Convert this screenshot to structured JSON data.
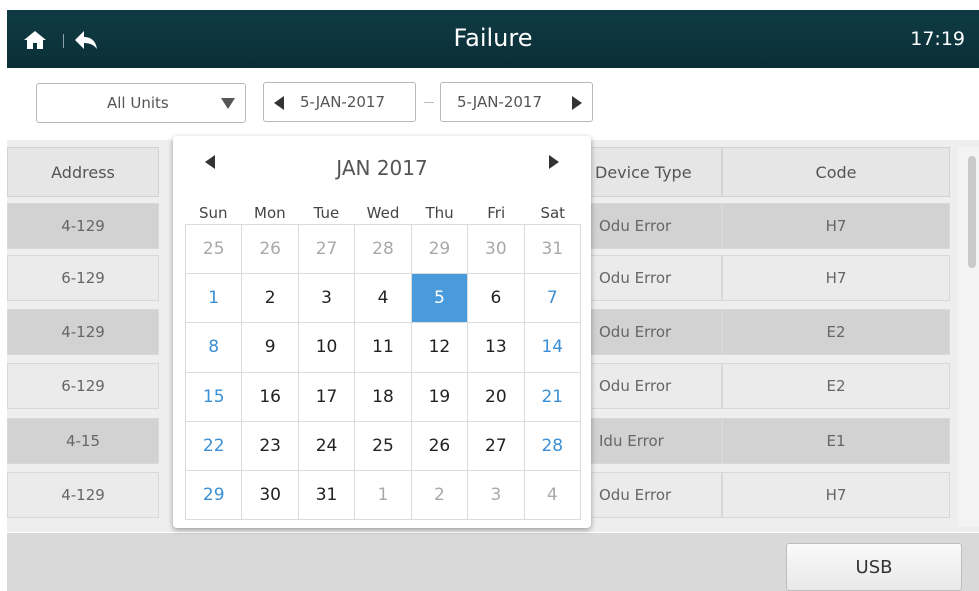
{
  "header": {
    "title": "Failure",
    "time": "17:19"
  },
  "filter": {
    "units_value": "All Units",
    "start_date": "5-JAN-2017",
    "end_date": "5-JAN-2017"
  },
  "table": {
    "columns": [
      "Address",
      "Device Type",
      "Code"
    ],
    "rows": [
      {
        "address": "4-129",
        "device": "Odu Error",
        "code": "H7"
      },
      {
        "address": "6-129",
        "device": "Odu Error",
        "code": "H7"
      },
      {
        "address": "4-129",
        "device": "Odu Error",
        "code": "E2"
      },
      {
        "address": "6-129",
        "device": "Odu Error",
        "code": "E2"
      },
      {
        "address": "4-15",
        "device": "Idu Error",
        "code": "E1"
      },
      {
        "address": "4-129",
        "device": "Odu Error",
        "code": "H7"
      }
    ]
  },
  "footer": {
    "usb_label": "USB"
  },
  "calendar": {
    "month_label": "JAN 2017",
    "weekdays": [
      "Sun",
      "Mon",
      "Tue",
      "Wed",
      "Thu",
      "Fri",
      "Sat"
    ],
    "days": [
      "25",
      "26",
      "27",
      "28",
      "29",
      "30",
      "31",
      "1",
      "2",
      "3",
      "4",
      "5",
      "6",
      "7",
      "8",
      "9",
      "10",
      "11",
      "12",
      "13",
      "14",
      "15",
      "16",
      "17",
      "18",
      "19",
      "20",
      "21",
      "22",
      "23",
      "24",
      "25",
      "26",
      "27",
      "28",
      "29",
      "30",
      "31",
      "1",
      "2",
      "3",
      "4"
    ],
    "selected_day": "5",
    "colors": {
      "selected": "#4a9bdc",
      "weekend": "#3a8fd6",
      "muted": "#a9a9a9"
    }
  }
}
